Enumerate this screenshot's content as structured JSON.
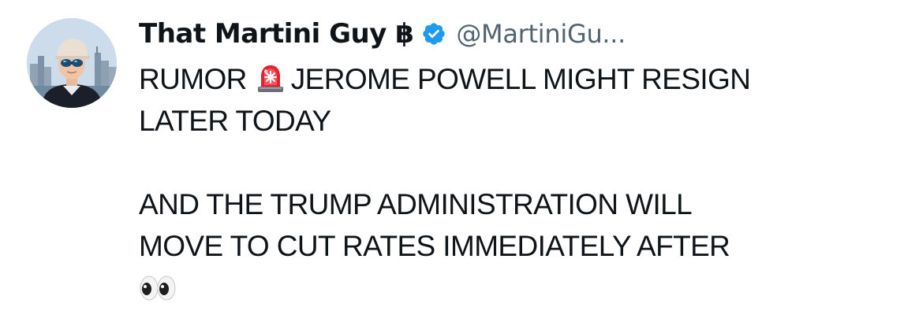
{
  "author": {
    "display_name": "That Martini Guy ฿",
    "handle": "@MartiniGu...",
    "verified": true,
    "verified_color": "#1d9bf0",
    "avatar_icon": "profile-photo"
  },
  "tweet": {
    "line1_prefix": "RUMOR",
    "line1_icon": "police-siren-emoji",
    "line1_suffix": "JEROME POWELL MIGHT RESIGN",
    "line2": "LATER TODAY",
    "line4": "AND THE TRUMP ADMINISTRATION WILL",
    "line5": "MOVE TO CUT RATES IMMEDIATELY AFTER",
    "line6_icon": "eyes-emoji"
  },
  "colors": {
    "text": "#0f1419",
    "secondary_text": "#536471",
    "background": "#ffffff"
  }
}
